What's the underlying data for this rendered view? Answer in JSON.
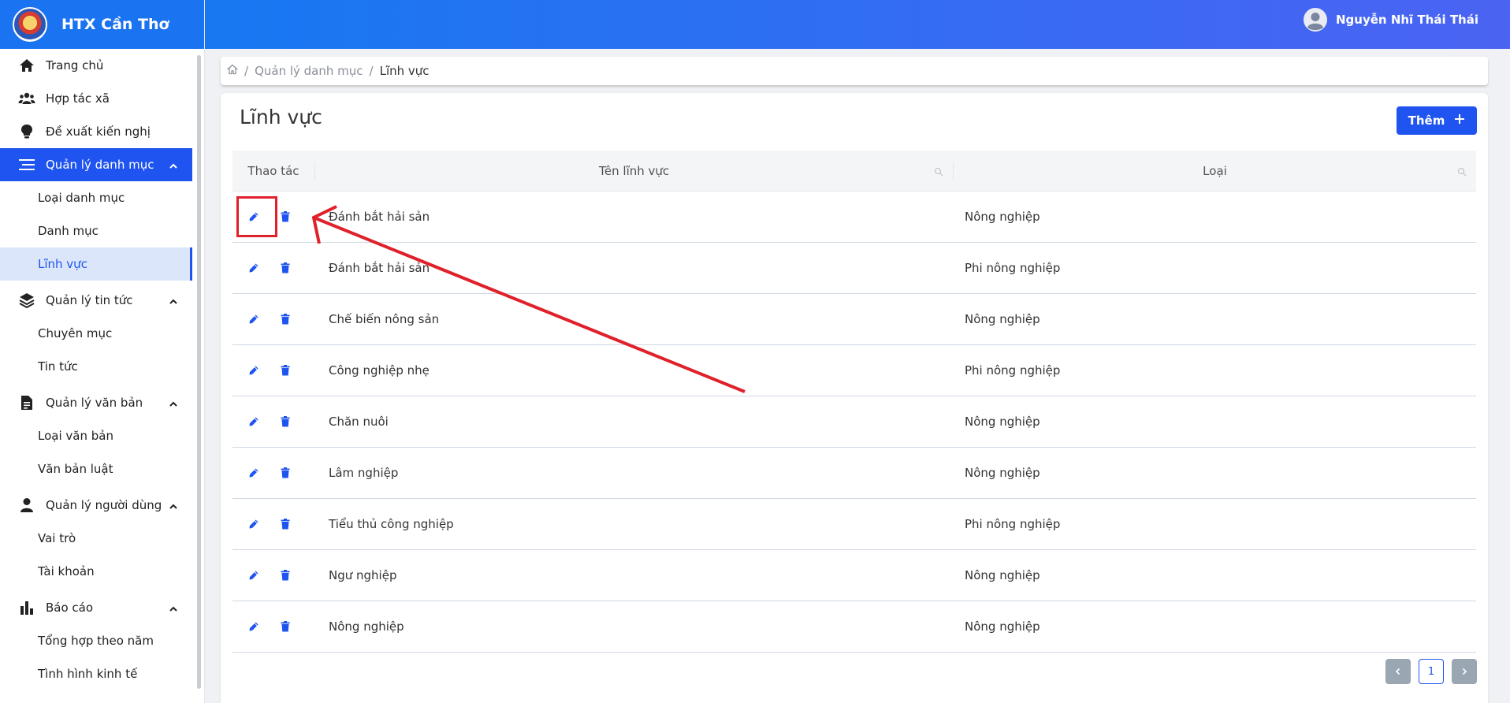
{
  "brand": {
    "title": "HTX Cần Thơ"
  },
  "user": {
    "name": "Nguyễn Nhĩ Thái Thái"
  },
  "sidebar": {
    "items": [
      {
        "label": "Trang chủ"
      },
      {
        "label": "Hợp tác xã"
      },
      {
        "label": "Đề xuất kiến nghị"
      },
      {
        "label": "Quản lý danh mục",
        "sub": [
          "Loại danh mục",
          "Danh mục",
          "Lĩnh vực"
        ]
      },
      {
        "label": "Quản lý tin tức",
        "sub": [
          "Chuyên mục",
          "Tin tức"
        ]
      },
      {
        "label": "Quản lý văn bản",
        "sub": [
          "Loại văn bản",
          "Văn bản luật"
        ]
      },
      {
        "label": "Quản lý người dùng",
        "sub": [
          "Vai trò",
          "Tài khoản"
        ]
      },
      {
        "label": "Báo cáo",
        "sub": [
          "Tổng hợp theo năm",
          "Tình hình kinh tế"
        ]
      }
    ]
  },
  "breadcrumb": {
    "parent": "Quản lý danh mục",
    "current": "Lĩnh vực"
  },
  "page": {
    "title": "Lĩnh vực",
    "add_label": "Thêm"
  },
  "table": {
    "headers": {
      "actions": "Thao tác",
      "name": "Tên lĩnh vực",
      "type": "Loại"
    },
    "rows": [
      {
        "name": "Đánh bắt hải sản",
        "type": "Nông nghiệp"
      },
      {
        "name": "Đánh bắt hải sản",
        "type": "Phi nông nghiệp"
      },
      {
        "name": "Chế biến nông sản",
        "type": "Nông nghiệp"
      },
      {
        "name": "Công nghiệp nhẹ",
        "type": "Phi nông nghiệp"
      },
      {
        "name": "Chăn nuôi",
        "type": "Nông nghiệp"
      },
      {
        "name": "Lâm nghiệp",
        "type": "Nông nghiệp"
      },
      {
        "name": "Tiểu thủ công nghiệp",
        "type": "Phi nông nghiệp"
      },
      {
        "name": "Ngư nghiệp",
        "type": "Nông nghiệp"
      },
      {
        "name": "Nông nghiệp",
        "type": "Nông nghiệp"
      }
    ]
  },
  "pagination": {
    "current_page": "1"
  },
  "colors": {
    "primary": "#1f54f0",
    "annotation": "#e0202a"
  }
}
